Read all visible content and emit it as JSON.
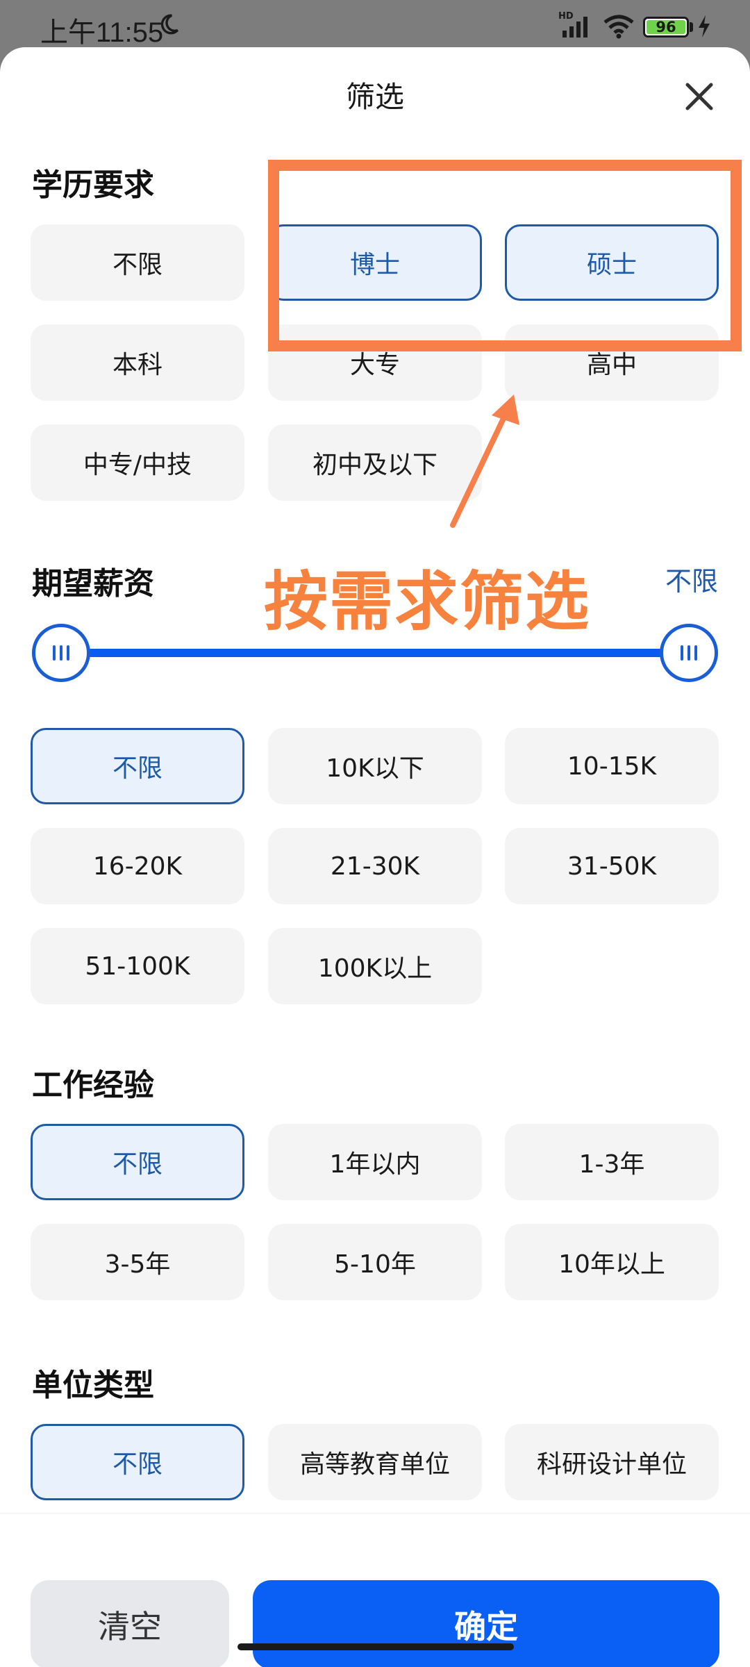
{
  "status_bar": {
    "time": "上午11:55",
    "battery": "96",
    "network": "HD"
  },
  "sheet": {
    "title": "筛选"
  },
  "education": {
    "title": "学历要求",
    "options": [
      "不限",
      "博士",
      "硕士",
      "本科",
      "大专",
      "高中",
      "中专/中技",
      "初中及以下"
    ],
    "selected": [
      "博士",
      "硕士"
    ]
  },
  "salary": {
    "title": "期望薪资",
    "range_label": "不限",
    "options": [
      "不限",
      "10K以下",
      "10-15K",
      "16-20K",
      "21-30K",
      "31-50K",
      "51-100K",
      "100K以上"
    ],
    "selected": [
      "不限"
    ]
  },
  "experience": {
    "title": "工作经验",
    "options": [
      "不限",
      "1年以内",
      "1-3年",
      "3-5年",
      "5-10年",
      "10年以上"
    ],
    "selected": [
      "不限"
    ]
  },
  "unit_type": {
    "title": "单位类型",
    "options": [
      "不限",
      "高等教育单位",
      "科研设计单位"
    ],
    "selected": [
      "不限"
    ]
  },
  "annotation": {
    "callout": "按需求筛选",
    "color": "#f7804a"
  },
  "actions": {
    "clear": "清空",
    "confirm": "确定"
  },
  "colors": {
    "accent": "#0a60f5",
    "selected_border": "#1e5aa8",
    "selected_bg": "#e9f1fd",
    "chip_bg": "#f4f4f4"
  }
}
